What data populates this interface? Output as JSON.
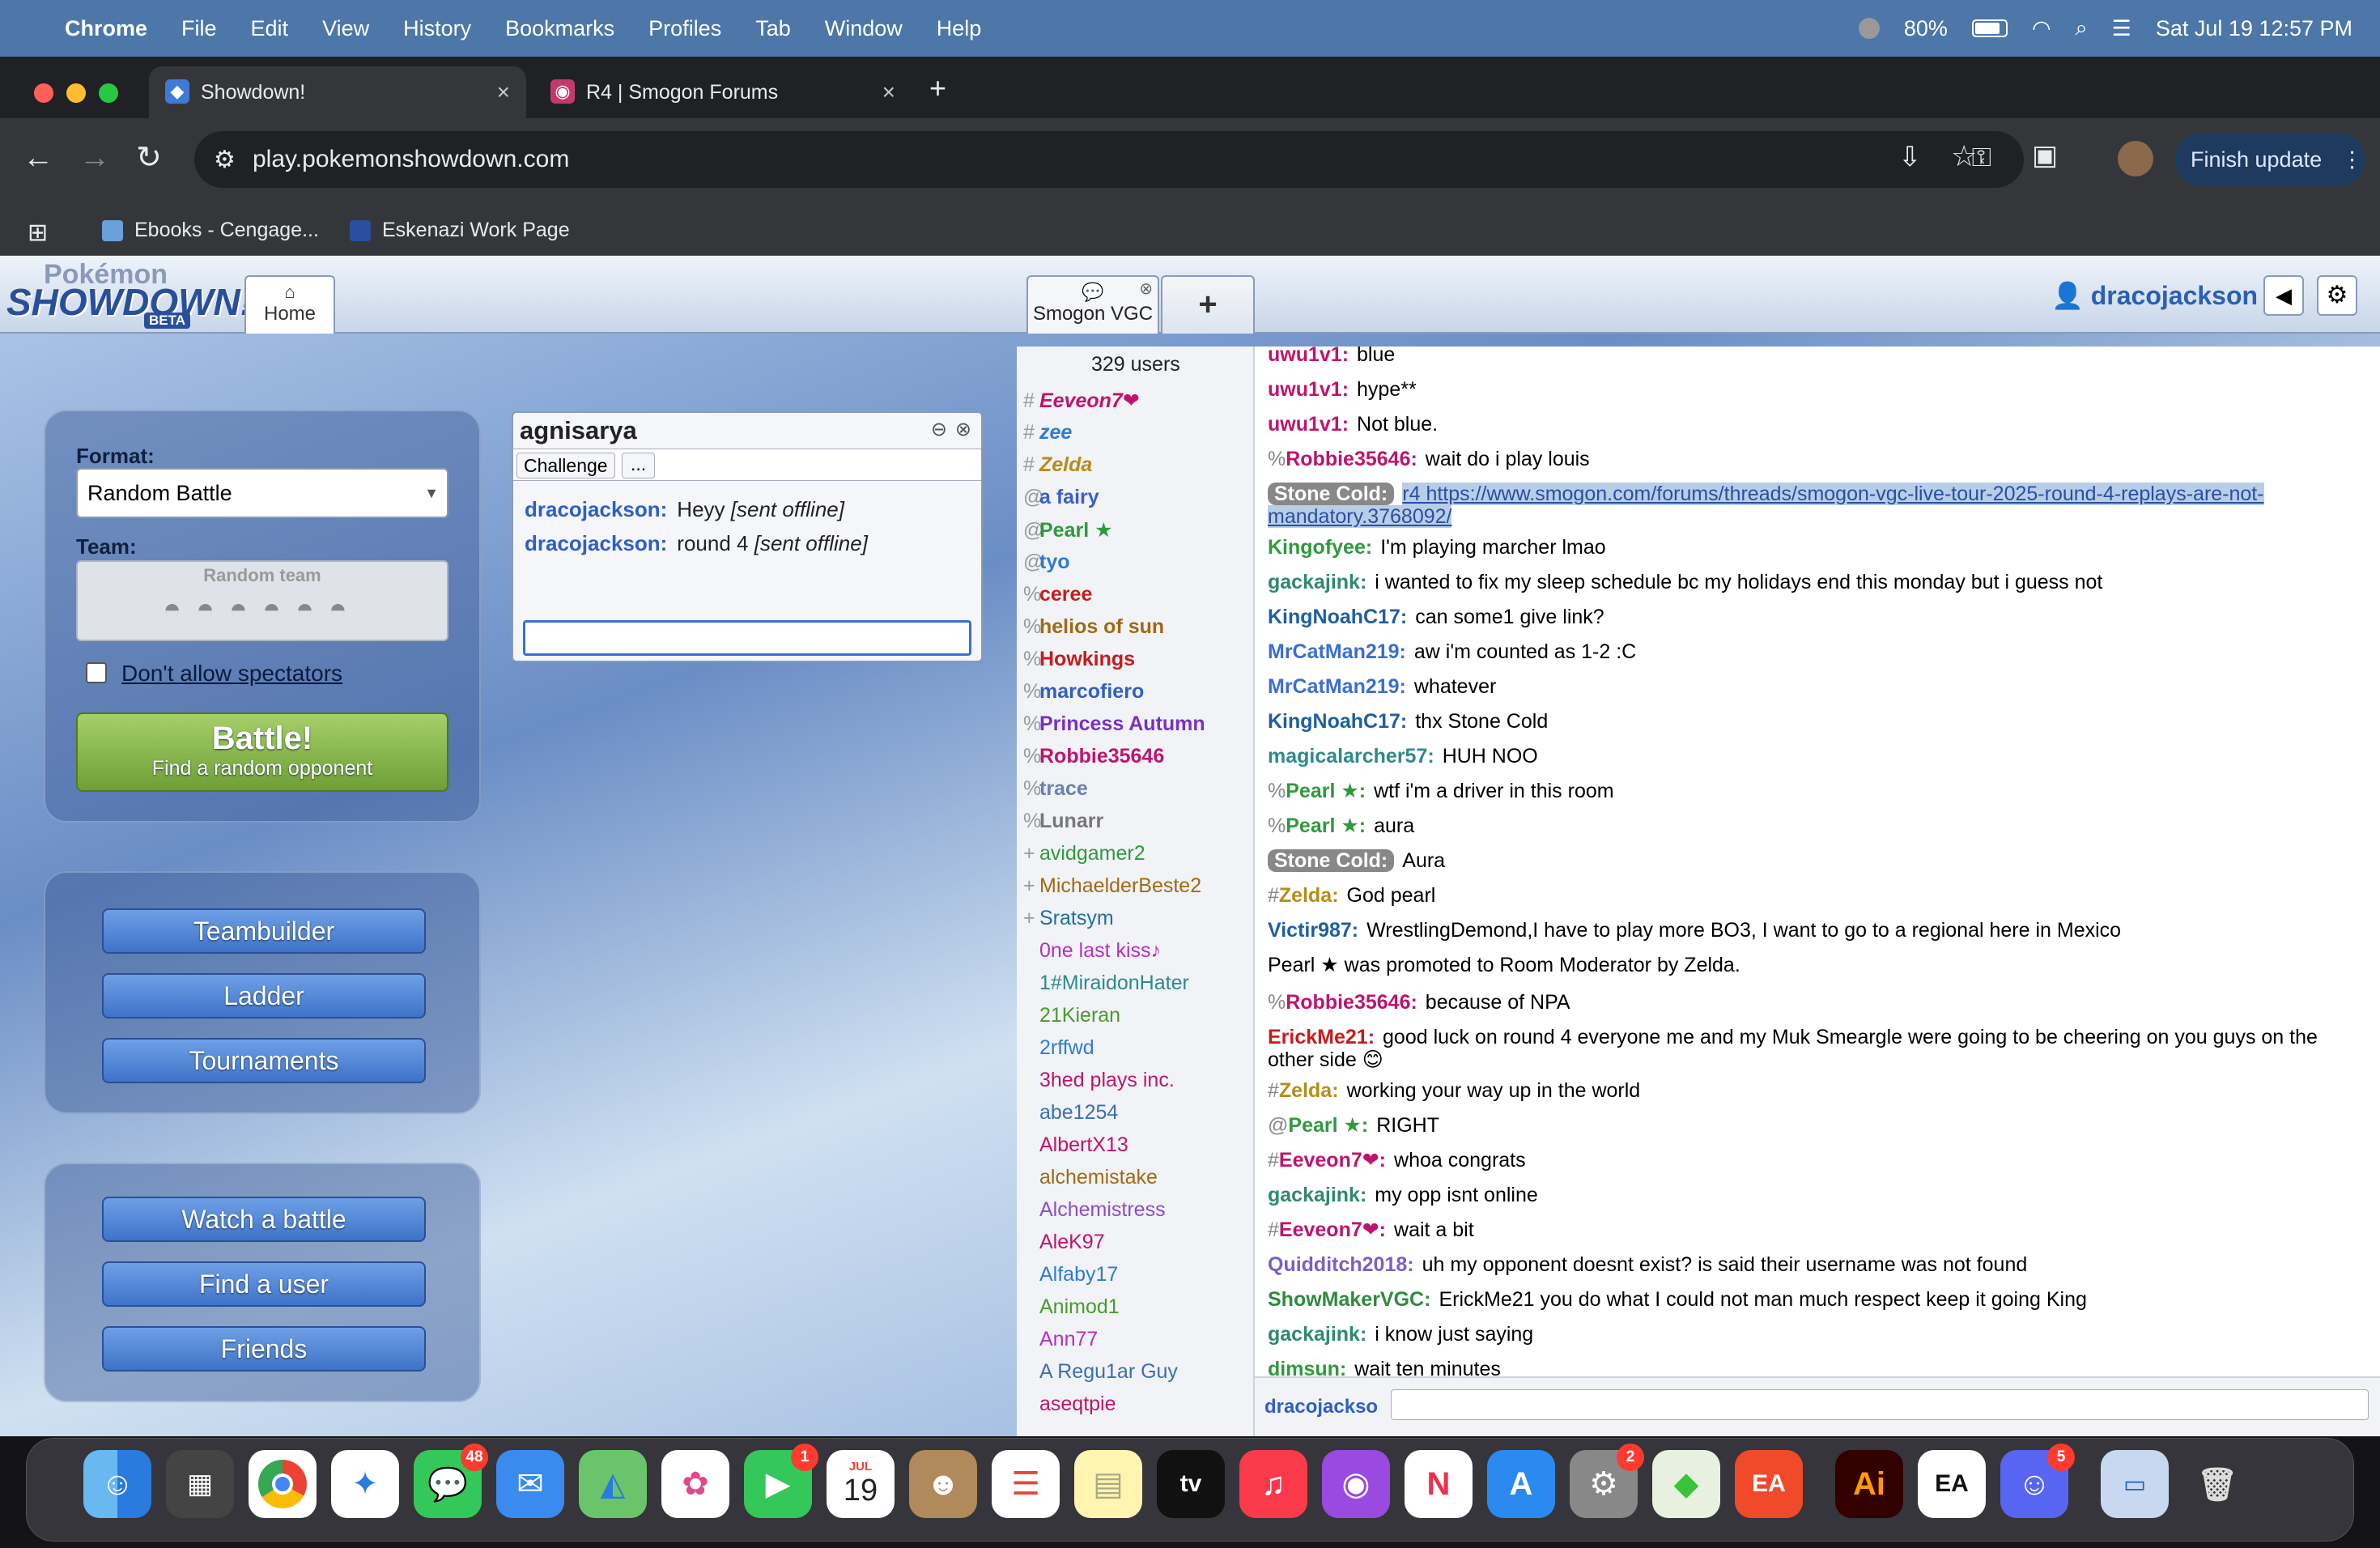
{
  "menubar": {
    "items": [
      "Chrome",
      "File",
      "Edit",
      "View",
      "History",
      "Bookmarks",
      "Profiles",
      "Tab",
      "Window",
      "Help"
    ],
    "battery": "80%",
    "datetime": "Sat Jul 19  12:57 PM"
  },
  "browser": {
    "tabs": [
      {
        "title": "Showdown!",
        "close": "×"
      },
      {
        "title": "R4 | Smogon Forums",
        "close": "×"
      }
    ],
    "new_tab": "+",
    "url": "play.pokemonshowdown.com",
    "finish_update": "Finish update",
    "bookmarks": [
      "Ebooks - Cengage...",
      "Eskenazi Work Page"
    ]
  },
  "sd": {
    "logo_top": "Pokémon",
    "logo_main": "SHOWDOWN!",
    "logo_beta": "BETA",
    "home_tab": "Home",
    "room_tab": "Smogon VGC",
    "add_tab": "+",
    "username": "dracojackson",
    "format_label": "Format:",
    "format_value": "Random Battle",
    "team_label": "Team:",
    "team_value": "Random team",
    "spectators": "Don't allow spectators",
    "battle": "Battle!",
    "battle_sub": "Find a random opponent",
    "buttons1": [
      "Teambuilder",
      "Ladder",
      "Tournaments"
    ],
    "buttons2": [
      "Watch a battle",
      "Find a user",
      "Friends"
    ],
    "pm": {
      "title": "agnisarya",
      "challenge": "Challenge",
      "more": "...",
      "messages": [
        {
          "user": "dracojackson:",
          "text": "Heyy",
          "note": "[sent offline]"
        },
        {
          "user": "dracojackson:",
          "text": "round 4",
          "note": "[sent offline]"
        }
      ]
    },
    "user_count": "329 users",
    "users": [
      {
        "rank": "#",
        "name": "Eeveon7❤",
        "color": "#c0136f",
        "style": "italic"
      },
      {
        "rank": "#",
        "name": "zee",
        "color": "#2f7bd1",
        "style": "italic"
      },
      {
        "rank": "#",
        "name": "Zelda",
        "color": "#b58e16",
        "style": "italic"
      },
      {
        "rank": "@",
        "name": "a fairy",
        "color": "#3a5fc8",
        "style": "bold"
      },
      {
        "rank": "@",
        "name": "Pearl ★",
        "color": "#2f9a3d",
        "style": "bold"
      },
      {
        "rank": "@",
        "name": "tyo",
        "color": "#2f7bd1",
        "style": "bold"
      },
      {
        "rank": "%",
        "name": "ceree",
        "color": "#c51c1c",
        "style": "bold"
      },
      {
        "rank": "%",
        "name": "helios of sun",
        "color": "#a06a14",
        "style": "bold"
      },
      {
        "rank": "%",
        "name": "Howkings",
        "color": "#c51c1c",
        "style": "bold"
      },
      {
        "rank": "%",
        "name": "marcofiero",
        "color": "#2f5fc4",
        "style": "bold"
      },
      {
        "rank": "%",
        "name": "Princess Autumn",
        "color": "#7b2fc4",
        "style": "bold"
      },
      {
        "rank": "%",
        "name": "Robbie35646",
        "color": "#c0136f",
        "style": "bold"
      },
      {
        "rank": "%",
        "name": "trace",
        "color": "#6d7fb0",
        "style": "bold"
      },
      {
        "rank": "%",
        "name": "Lunarr",
        "color": "#777777",
        "style": "bold"
      },
      {
        "rank": "+",
        "name": "avidgamer2",
        "color": "#2f9a3d",
        "style": ""
      },
      {
        "rank": "+",
        "name": "MichaelderBeste2",
        "color": "#a06a14",
        "style": ""
      },
      {
        "rank": "+",
        "name": "Sratsym",
        "color": "#1f6fa0",
        "style": ""
      },
      {
        "rank": "",
        "name": "0ne last kiss♪",
        "color": "#b32fc4",
        "style": ""
      },
      {
        "rank": "",
        "name": "1#MiraidonHater",
        "color": "#2f8a8a",
        "style": ""
      },
      {
        "rank": "",
        "name": "21Kieran",
        "color": "#4a9a2f",
        "style": ""
      },
      {
        "rank": "",
        "name": "2rffwd",
        "color": "#2f7bd1",
        "style": ""
      },
      {
        "rank": "",
        "name": "3hed plays inc.",
        "color": "#c0136f",
        "style": ""
      },
      {
        "rank": "",
        "name": "abe1254",
        "color": "#3a6fb0",
        "style": ""
      },
      {
        "rank": "",
        "name": "AlbertX13",
        "color": "#c0136f",
        "style": ""
      },
      {
        "rank": "",
        "name": "alchemistake",
        "color": "#a06a14",
        "style": ""
      },
      {
        "rank": "",
        "name": "Alchemistress",
        "color": "#8a4fc4",
        "style": ""
      },
      {
        "rank": "",
        "name": "AleK97",
        "color": "#c0136f",
        "style": ""
      },
      {
        "rank": "",
        "name": "Alfaby17",
        "color": "#2f7bd1",
        "style": ""
      },
      {
        "rank": "",
        "name": "Animod1",
        "color": "#4a9a2f",
        "style": ""
      },
      {
        "rank": "",
        "name": "Ann77",
        "color": "#b32fc4",
        "style": ""
      },
      {
        "rank": "",
        "name": "A Regu1ar Guy",
        "color": "#3a6fb0",
        "style": ""
      },
      {
        "rank": "",
        "name": "aseqtpie",
        "color": "#c0136f",
        "style": ""
      }
    ],
    "chat": [
      {
        "rank": "",
        "user": "uwu1v1:",
        "color": "#c0136f",
        "text": "blue"
      },
      {
        "rank": "",
        "user": "uwu1v1:",
        "color": "#c0136f",
        "text": "hype**"
      },
      {
        "rank": "",
        "user": "uwu1v1:",
        "color": "#c0136f",
        "text": "Not blue."
      },
      {
        "rank": "%",
        "user": "Robbie35646:",
        "color": "#c0136f",
        "text": "wait do i play louis"
      },
      {
        "rank": "",
        "user": "Stone Cold:",
        "color": "#ffffff",
        "text": "r4 https://www.smogon.com/forums/threads/smogon-vgc-live-tour-2025-round-4-replays-are-not-mandatory.3768092/",
        "hl": true
      },
      {
        "rank": "",
        "user": "Kingofyee:",
        "color": "#2f9a3d",
        "text": "I'm playing marcher lmao"
      },
      {
        "rank": "",
        "user": "gackajink:",
        "color": "#2f8a6a",
        "text": "i wanted to fix my sleep schedule bc my holidays end this monday but i guess not"
      },
      {
        "rank": "",
        "user": "KingNoahC17:",
        "color": "#1f5fa0",
        "text": "can some1 give link?"
      },
      {
        "rank": "",
        "user": "MrCatMan219:",
        "color": "#3a6fd0",
        "text": "aw i'm counted as 1-2 :C"
      },
      {
        "rank": "",
        "user": "MrCatMan219:",
        "color": "#3a6fd0",
        "text": "whatever"
      },
      {
        "rank": "",
        "user": "KingNoahC17:",
        "color": "#1f5fa0",
        "text": "thx Stone Cold"
      },
      {
        "rank": "",
        "user": "magicalarcher57:",
        "color": "#2f8a8a",
        "text": "HUH NOO"
      },
      {
        "rank": "%",
        "user": "Pearl ★:",
        "color": "#2f9a3d",
        "text": "wtf i'm a driver in this room"
      },
      {
        "rank": "%",
        "user": "Pearl ★:",
        "color": "#2f9a3d",
        "text": "aura"
      },
      {
        "rank": "",
        "user": "Stone Cold:",
        "color": "#ffffff",
        "text": "Aura",
        "hl": true
      },
      {
        "rank": "#",
        "user": "Zelda:",
        "color": "#b58e16",
        "text": "God pearl"
      },
      {
        "rank": "",
        "user": "Victir987:",
        "color": "#1f5fa0",
        "text": "WrestlingDemond,I have to play more BO3, I want to go to a regional here in Mexico"
      },
      {
        "rank": "",
        "user": "",
        "color": "#000",
        "text": "Pearl ★ was promoted to Room Moderator by Zelda."
      },
      {
        "rank": "%",
        "user": "Robbie35646:",
        "color": "#c0136f",
        "text": "because of NPA"
      },
      {
        "rank": "",
        "user": "ErickMe21:",
        "color": "#c51c1c",
        "text": "good luck on round 4 everyone me and my Muk Smeargle were going to be cheering on you guys on the other side 😊"
      },
      {
        "rank": "#",
        "user": "Zelda:",
        "color": "#b58e16",
        "text": "working your way up in the world"
      },
      {
        "rank": "@",
        "user": "Pearl ★:",
        "color": "#2f9a3d",
        "text": "RIGHT"
      },
      {
        "rank": "#",
        "user": "Eeveon7❤:",
        "color": "#c0136f",
        "text": "whoa congrats"
      },
      {
        "rank": "",
        "user": "gackajink:",
        "color": "#2f8a6a",
        "text": "my opp isnt online"
      },
      {
        "rank": "#",
        "user": "Eeveon7❤:",
        "color": "#c0136f",
        "text": "wait a bit"
      },
      {
        "rank": "",
        "user": "Quidditch2018:",
        "color": "#7b5fc4",
        "text": "uh my opponent doesnt exist? is said their username was not found"
      },
      {
        "rank": "",
        "user": "ShowMakerVGC:",
        "color": "#2f8a3d",
        "text": "ErickMe21 you do what I could not man much respect keep it going King"
      },
      {
        "rank": "",
        "user": "gackajink:",
        "color": "#2f8a6a",
        "text": "i know just saying"
      },
      {
        "rank": "",
        "user": "dimsun:",
        "color": "#2f9a3d",
        "text": "wait ten minutes"
      }
    ],
    "chat_user": "dracojackso"
  },
  "dock": {
    "messages_badge": "48",
    "facetime_badge": "1",
    "settings_badge": "2",
    "discord_badge": "5",
    "calendar_month": "JUL",
    "calendar_day": "19",
    "appletv": "tv",
    "ai": "Ai",
    "ea": "EA"
  }
}
